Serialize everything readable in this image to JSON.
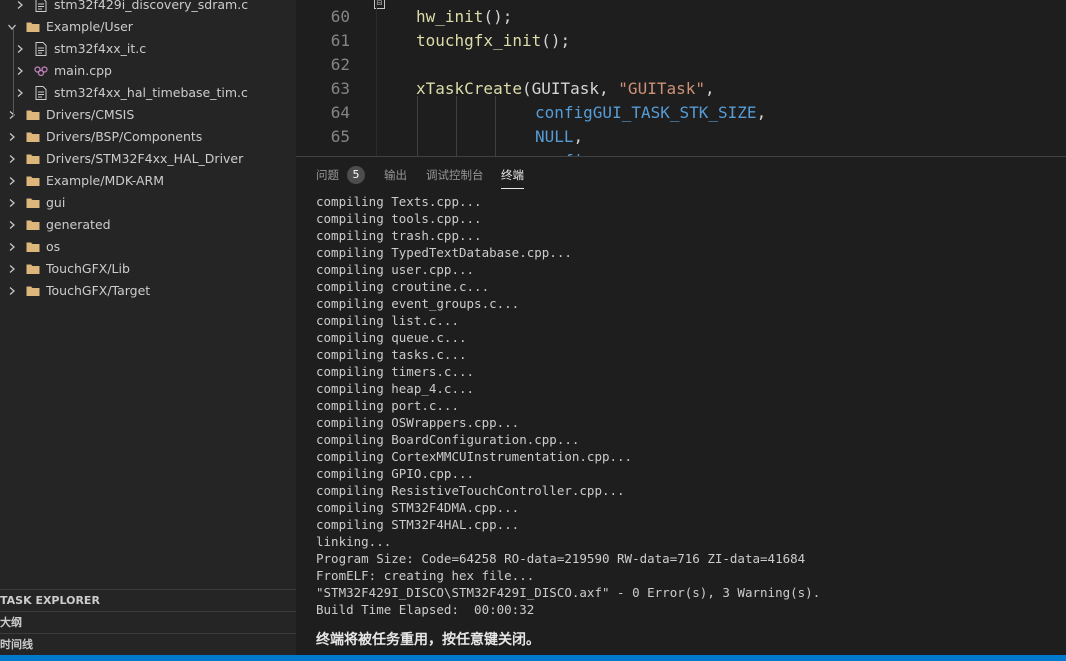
{
  "explorer": {
    "items": [
      {
        "label": "stm32f429i_discovery_sdram.c",
        "icon": "c-file-icon",
        "level": 1,
        "chevron": "right"
      },
      {
        "label": "Example/User",
        "icon": "folder-icon",
        "level": 0,
        "chevron": "down"
      },
      {
        "label": "stm32f4xx_it.c",
        "icon": "c-file-icon",
        "level": 1,
        "chevron": "right"
      },
      {
        "label": "main.cpp",
        "icon": "cpp-file-icon",
        "level": 1,
        "chevron": "right"
      },
      {
        "label": "stm32f4xx_hal_timebase_tim.c",
        "icon": "c-file-icon",
        "level": 1,
        "chevron": "right"
      },
      {
        "label": "Drivers/CMSIS",
        "icon": "folder-icon",
        "level": 0,
        "chevron": "right"
      },
      {
        "label": "Drivers/BSP/Components",
        "icon": "folder-icon",
        "level": 0,
        "chevron": "right"
      },
      {
        "label": "Drivers/STM32F4xx_HAL_Driver",
        "icon": "folder-icon",
        "level": 0,
        "chevron": "right"
      },
      {
        "label": "Example/MDK-ARM",
        "icon": "folder-icon",
        "level": 0,
        "chevron": "right"
      },
      {
        "label": "gui",
        "icon": "folder-icon",
        "level": 0,
        "chevron": "right"
      },
      {
        "label": "generated",
        "icon": "folder-icon",
        "level": 0,
        "chevron": "right"
      },
      {
        "label": "os",
        "icon": "folder-icon",
        "level": 0,
        "chevron": "right"
      },
      {
        "label": "TouchGFX/Lib",
        "icon": "folder-icon",
        "level": 0,
        "chevron": "right"
      },
      {
        "label": "TouchGFX/Target",
        "icon": "folder-icon",
        "level": 0,
        "chevron": "right"
      }
    ]
  },
  "sections": {
    "task_explorer": "TASK EXPLORER",
    "outline": "大纲",
    "timeline": "时间线"
  },
  "editor": {
    "lines": [
      {
        "num": "60",
        "parts": [
          {
            "t": "hw_init",
            "c": "fn"
          },
          {
            "t": "();",
            "c": "pun"
          }
        ]
      },
      {
        "num": "61",
        "parts": [
          {
            "t": "touchgfx_init",
            "c": "fn"
          },
          {
            "t": "();",
            "c": "pun"
          }
        ]
      },
      {
        "num": "62",
        "parts": []
      },
      {
        "num": "63",
        "parts": [
          {
            "t": "xTaskCreate",
            "c": "fn"
          },
          {
            "t": "(GUITask, ",
            "c": "pun"
          },
          {
            "t": "\"GUITask\"",
            "c": "str"
          },
          {
            "t": ",",
            "c": "pun"
          }
        ]
      },
      {
        "num": "64",
        "parts": [
          {
            "t": "configGUI_TASK_STK_SIZE",
            "c": "mac"
          },
          {
            "t": ",",
            "c": "pun"
          }
        ]
      },
      {
        "num": "65",
        "parts": [
          {
            "t": "NULL",
            "c": "mac"
          },
          {
            "t": ",",
            "c": "pun"
          }
        ]
      },
      {
        "num": "",
        "parts": [
          {
            "t": "confi",
            "c": "mac"
          }
        ]
      }
    ]
  },
  "panel": {
    "tabs": {
      "problems": "问题",
      "problems_count": "5",
      "output": "输出",
      "debug_console": "调试控制台",
      "terminal": "终端"
    },
    "terminal_lines": [
      "compiling Texts.cpp...",
      "compiling tools.cpp...",
      "compiling trash.cpp...",
      "compiling TypedTextDatabase.cpp...",
      "compiling user.cpp...",
      "compiling croutine.c...",
      "compiling event_groups.c...",
      "compiling list.c...",
      "compiling queue.c...",
      "compiling tasks.c...",
      "compiling timers.c...",
      "compiling heap_4.c...",
      "compiling port.c...",
      "compiling OSWrappers.cpp...",
      "compiling BoardConfiguration.cpp...",
      "compiling CortexMMCUInstrumentation.cpp...",
      "compiling GPIO.cpp...",
      "compiling ResistiveTouchController.cpp...",
      "compiling STM32F4DMA.cpp...",
      "compiling STM32F4HAL.cpp...",
      "linking...",
      "Program Size: Code=64258 RO-data=219590 RW-data=716 ZI-data=41684",
      "FromELF: creating hex file...",
      "\"STM32F429I_DISCO\\STM32F429I_DISCO.axf\" - 0 Error(s), 3 Warning(s).",
      "Build Time Elapsed:  00:00:32"
    ],
    "terminal_notice": "终端将被任务重用，按任意键关闭。"
  },
  "colors": {
    "folder": "#dcb67a",
    "c_file": "#cccccc",
    "cpp_file": "#c586c0",
    "status_bar": "#007acc"
  }
}
